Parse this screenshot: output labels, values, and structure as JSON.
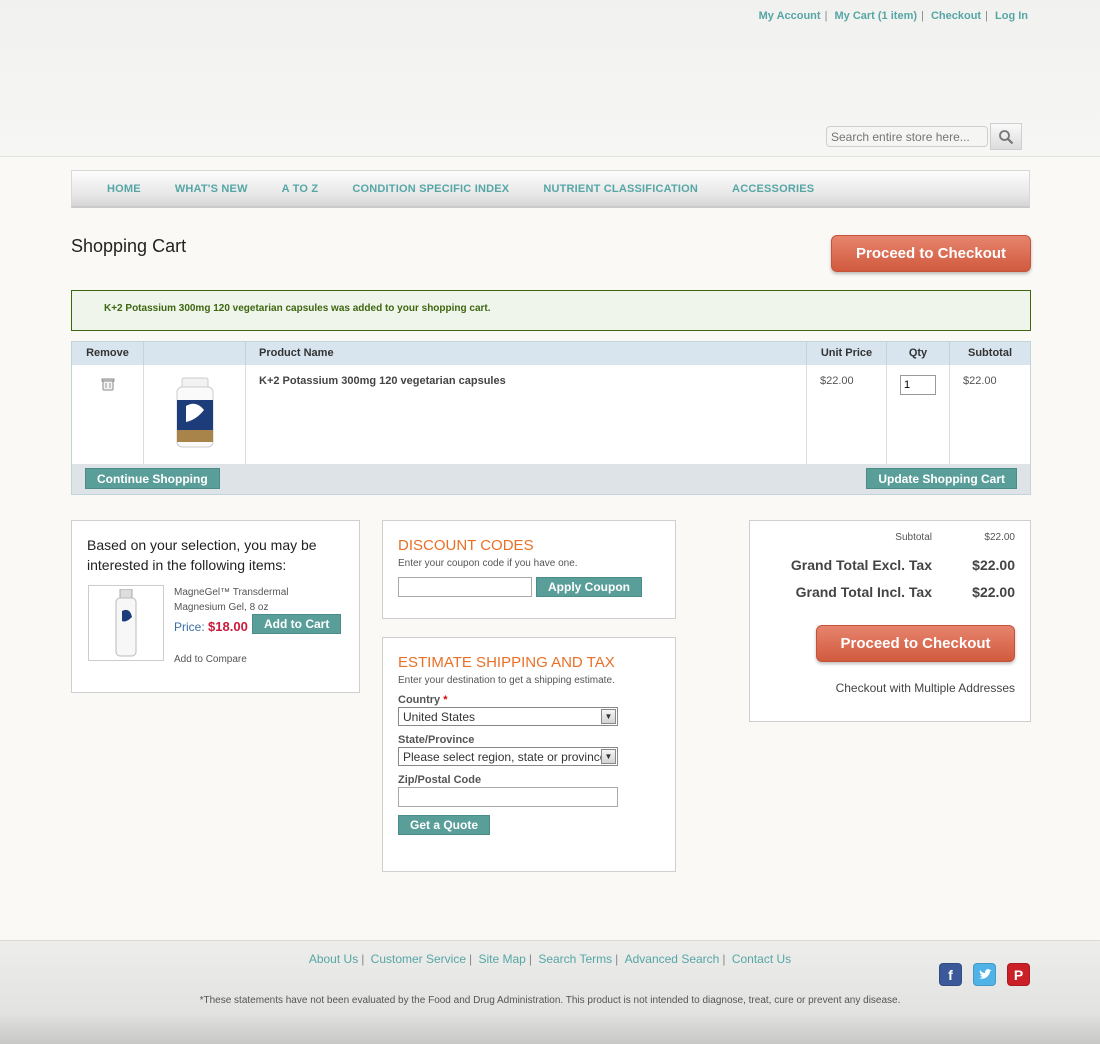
{
  "header": {
    "links": [
      "My Account",
      "My Cart (1 item)",
      "Checkout",
      "Log In"
    ],
    "search_placeholder": "Search entire store here..."
  },
  "nav": {
    "items": [
      "HOME",
      "WHAT'S NEW",
      "A TO Z",
      "CONDITION SPECIFIC INDEX",
      "NUTRIENT CLASSIFICATION",
      "ACCESSORIES"
    ]
  },
  "page": {
    "title": "Shopping Cart",
    "checkout_label": "Proceed to Checkout",
    "success_message": "K+2 Potassium 300mg 120 vegetarian capsules was added to your shopping cart."
  },
  "cart": {
    "headers": {
      "remove": "Remove",
      "name": "Product Name",
      "unit_price": "Unit Price",
      "qty": "Qty",
      "subtotal": "Subtotal"
    },
    "item": {
      "name": "K+2 Potassium 300mg 120 vegetarian capsules",
      "unit_price": "$22.00",
      "qty": "1",
      "subtotal": "$22.00"
    },
    "continue_label": "Continue Shopping",
    "update_label": "Update Shopping Cart"
  },
  "crosssell": {
    "heading": "Based on your selection, you may be interested in the following items:",
    "product_name": "MagneGel™ Transdermal Magnesium Gel, 8 oz",
    "price_label": "Price:",
    "price": "$18.00",
    "add_to_cart": "Add to Cart",
    "compare": "Add to Compare"
  },
  "discount": {
    "title": "DISCOUNT CODES",
    "hint": "Enter your coupon code if you have one.",
    "value": "",
    "apply_label": "Apply Coupon"
  },
  "shipping": {
    "title": "ESTIMATE SHIPPING AND TAX",
    "hint": "Enter your destination to get a shipping estimate.",
    "country_label": "Country",
    "required_mark": "*",
    "country_value": "United States",
    "state_label": "State/Province",
    "state_value": "Please select region, state or province",
    "zip_label": "Zip/Postal Code",
    "zip_value": "",
    "quote_label": "Get a Quote"
  },
  "totals": {
    "subtotal_label": "Subtotal",
    "subtotal": "$22.00",
    "excl_label": "Grand Total Excl. Tax",
    "excl": "$22.00",
    "incl_label": "Grand Total Incl. Tax",
    "incl": "$22.00",
    "checkout_label": "Proceed to Checkout",
    "multi_label": "Checkout with Multiple Addresses"
  },
  "footer": {
    "links": [
      "About Us",
      "Customer Service",
      "Site Map",
      "Search Terms",
      "Advanced Search",
      "Contact Us"
    ],
    "disclaimer": "*These statements have not been evaluated by the Food and Drug Administration. This product is not intended to diagnose, treat, cure or prevent any disease."
  },
  "colors": {
    "accent_teal": "#56a6a6",
    "checkout_red": "#d9654a",
    "heading_orange": "#e87027",
    "price_red": "#cc1a3b",
    "success_green": "#3d6611"
  }
}
